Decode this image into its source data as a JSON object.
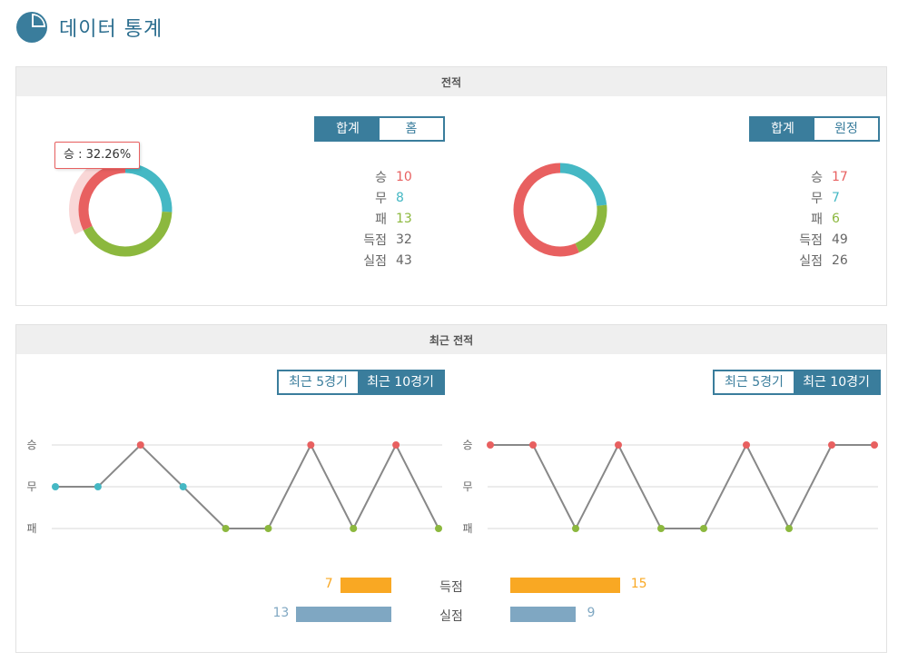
{
  "header": {
    "title": "데이터 통계"
  },
  "record": {
    "section_title": "전적",
    "left": {
      "tabs": [
        {
          "label": "합계",
          "active": true
        },
        {
          "label": "홈",
          "active": false
        }
      ],
      "stats": [
        {
          "label": "승",
          "value": "10",
          "color": "#e86060"
        },
        {
          "label": "무",
          "value": "8",
          "color": "#45b8c4"
        },
        {
          "label": "패",
          "value": "13",
          "color": "#8cb83e"
        },
        {
          "label": "득점",
          "value": "32",
          "color": "#666666"
        },
        {
          "label": "실점",
          "value": "43",
          "color": "#666666"
        }
      ],
      "tooltip": "승 : 32.26%"
    },
    "right": {
      "tabs": [
        {
          "label": "합계",
          "active": true
        },
        {
          "label": "원정",
          "active": false
        }
      ],
      "stats": [
        {
          "label": "승",
          "value": "17",
          "color": "#e86060"
        },
        {
          "label": "무",
          "value": "7",
          "color": "#45b8c4"
        },
        {
          "label": "패",
          "value": "6",
          "color": "#8cb83e"
        },
        {
          "label": "득점",
          "value": "49",
          "color": "#666666"
        },
        {
          "label": "실점",
          "value": "26",
          "color": "#666666"
        }
      ]
    }
  },
  "recent": {
    "section_title": "최근 전적",
    "left_tabs": [
      {
        "label": "최근 5경기",
        "active": false
      },
      {
        "label": "최근 10경기",
        "active": true
      }
    ],
    "right_tabs": [
      {
        "label": "최근 5경기",
        "active": false
      },
      {
        "label": "최근 10경기",
        "active": true
      }
    ],
    "goals_label": "득점",
    "conceded_label": "실점"
  },
  "colors": {
    "win": "#e86060",
    "draw": "#45b8c4",
    "loss": "#8cb83e",
    "accent": "#3a7d9c",
    "goals": "#f9a823",
    "conceded": "#7fa7c2"
  },
  "chart_data": [
    {
      "type": "pie",
      "variant": "donut",
      "categories": [
        "승",
        "무",
        "패"
      ],
      "values": [
        10,
        8,
        13
      ],
      "highlighted": "승"
    },
    {
      "type": "pie",
      "variant": "donut",
      "categories": [
        "승",
        "무",
        "패"
      ],
      "values": [
        17,
        7,
        6
      ]
    },
    {
      "type": "line",
      "y_categories": [
        "승",
        "무",
        "패"
      ],
      "values": [
        "무",
        "무",
        "승",
        "무",
        "패",
        "패",
        "승",
        "패",
        "승",
        "패"
      ]
    },
    {
      "type": "line",
      "y_categories": [
        "승",
        "무",
        "패"
      ],
      "values": [
        "승",
        "승",
        "패",
        "승",
        "패",
        "패",
        "승",
        "패",
        "승",
        "승"
      ]
    },
    {
      "type": "bar",
      "orientation": "horizontal",
      "categories": [
        "득점",
        "실점"
      ],
      "series": [
        {
          "values": [
            7,
            13
          ]
        },
        {
          "values": [
            15,
            9
          ]
        }
      ]
    }
  ]
}
